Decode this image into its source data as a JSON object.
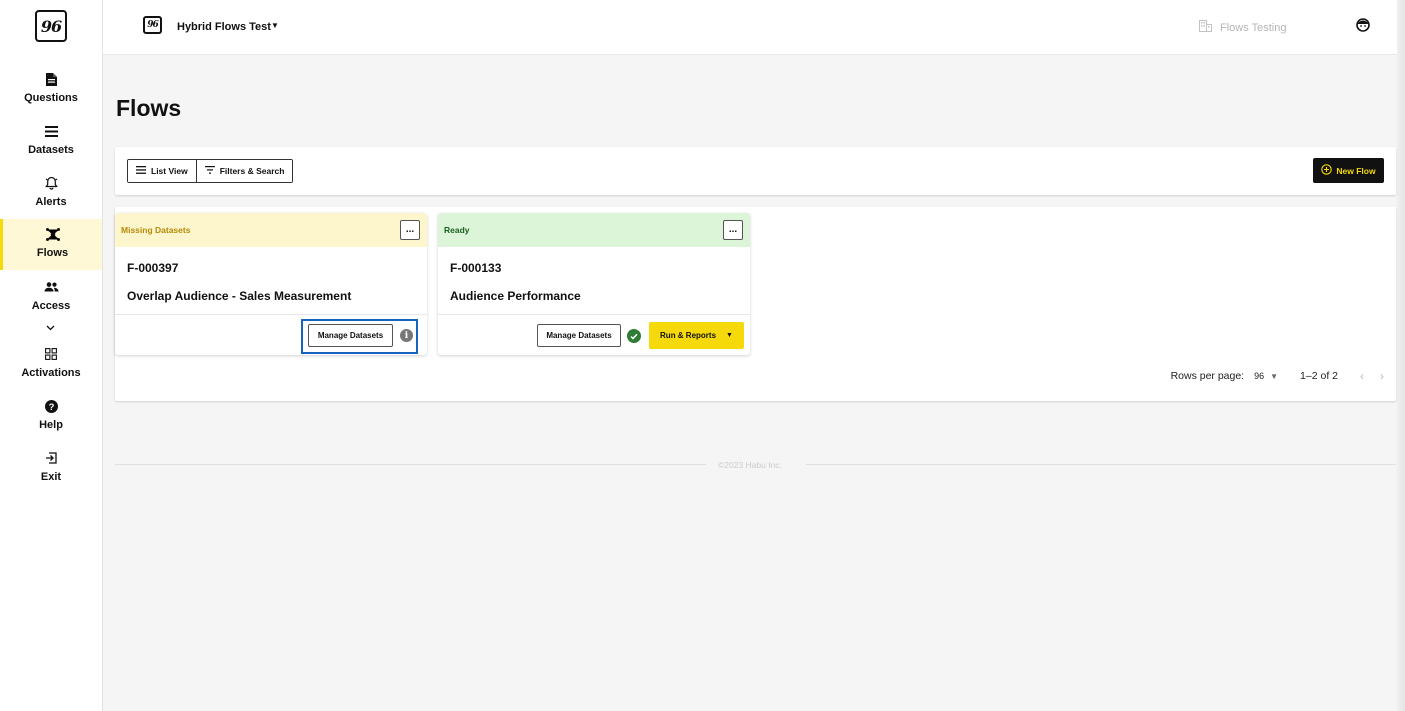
{
  "sidebar": {
    "logo_text": "96",
    "items": [
      {
        "label": "Questions",
        "icon": "document-icon"
      },
      {
        "label": "Datasets",
        "icon": "list-icon"
      },
      {
        "label": "Alerts",
        "icon": "bell-icon"
      },
      {
        "label": "Flows",
        "icon": "flow-icon",
        "active": true
      },
      {
        "label": "Access",
        "icon": "people-icon"
      },
      {
        "label": "Activations",
        "icon": "grid-icon"
      },
      {
        "label": "Help",
        "icon": "help-icon"
      },
      {
        "label": "Exit",
        "icon": "exit-icon"
      }
    ]
  },
  "topbar": {
    "org_logo_text": "96",
    "org_name": "Hybrid Flows Test",
    "environment": "Flows Testing"
  },
  "page": {
    "title": "Flows"
  },
  "toolbar": {
    "list_view": "List View",
    "filters_search": "Filters & Search",
    "new_flow": "New Flow"
  },
  "cards": [
    {
      "status": "Missing Datasets",
      "more": "...",
      "id": "F-000397",
      "name": "Overlap Audience - Sales Measurement",
      "manage_label": "Manage Datasets"
    },
    {
      "status": "Ready",
      "more": "...",
      "id": "F-000133",
      "name": "Audience Performance",
      "manage_label": "Manage Datasets",
      "run_label": "Run & Reports"
    }
  ],
  "pagination": {
    "rows_label": "Rows per page:",
    "rows_value": "96",
    "range": "1–2 of 2"
  },
  "footer": {
    "copyright": "©2023 Habu Inc."
  },
  "colors": {
    "accent": "#f5d90a",
    "missing_bg": "#fdf5cc",
    "ready_bg": "#dcf5d9",
    "highlight": "#1565c0"
  }
}
